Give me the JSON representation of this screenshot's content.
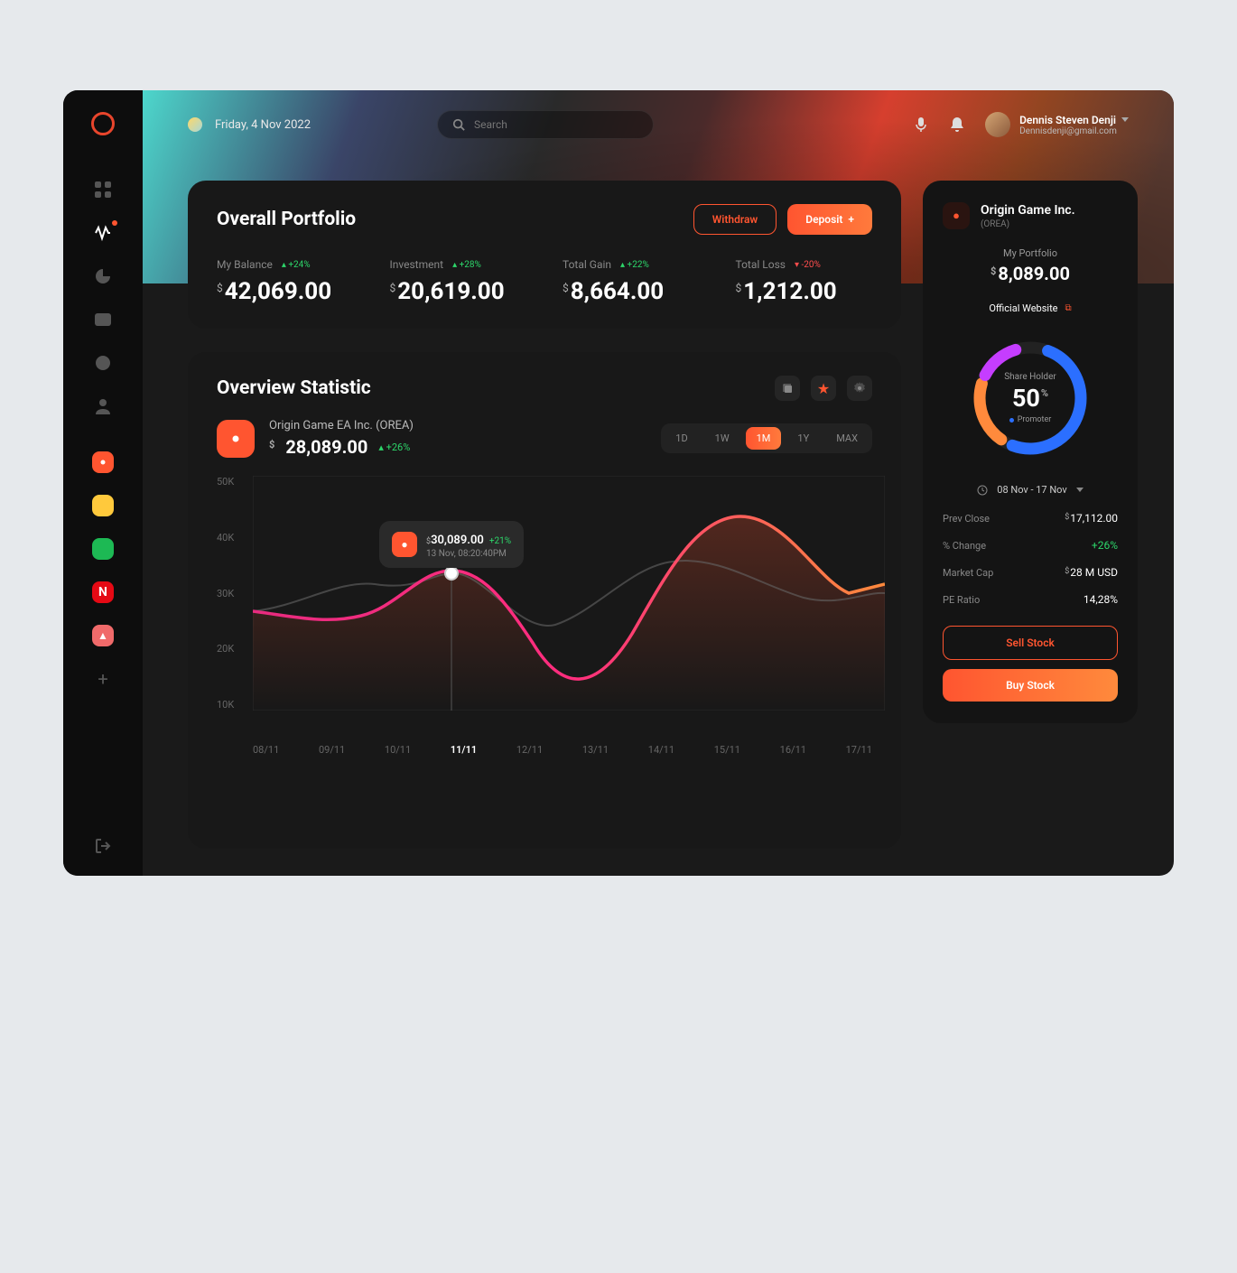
{
  "topbar": {
    "date": "Friday, 4 Nov 2022",
    "search_placeholder": "Search",
    "user_name": "Dennis Steven Denji",
    "user_email": "Dennisdenji@gmail.com"
  },
  "sidebar": {
    "nav": [
      "dashboard",
      "activity",
      "analytics",
      "wallet",
      "messages",
      "profile"
    ],
    "watchlist": [
      "origin",
      "bee",
      "spotify",
      "netflix",
      "asana"
    ]
  },
  "portfolio": {
    "title": "Overall Portfolio",
    "withdraw_label": "Withdraw",
    "deposit_label": "Deposit",
    "metrics": [
      {
        "label": "My Balance",
        "change": "+24%",
        "dir": "up",
        "value": "42,069.00"
      },
      {
        "label": "Investment",
        "change": "+28%",
        "dir": "up",
        "value": "20,619.00"
      },
      {
        "label": "Total Gain",
        "change": "+22%",
        "dir": "up",
        "value": "8,664.00"
      },
      {
        "label": "Total Loss",
        "change": "-20%",
        "dir": "down",
        "value": "1,212.00"
      }
    ]
  },
  "overview": {
    "title": "Overview Statistic",
    "stock_name": "Origin Game EA Inc. (OREA)",
    "stock_price": "28,089.00",
    "stock_change": "+26%",
    "ranges": [
      "1D",
      "1W",
      "1M",
      "1Y",
      "MAX"
    ],
    "range_active": "1M",
    "tooltip": {
      "price": "30,089.00",
      "change": "+21%",
      "date": "13 Nov, 08:20:40PM"
    },
    "y_labels": [
      "50K",
      "40K",
      "30K",
      "20K",
      "10K"
    ],
    "x_labels": [
      "08/11",
      "09/11",
      "10/11",
      "11/11",
      "12/11",
      "13/11",
      "14/11",
      "15/11",
      "16/11",
      "17/11"
    ],
    "x_active_index": 3
  },
  "detail": {
    "company_name": "Origin Game Inc.",
    "company_ticker": "(OREA)",
    "my_portfolio_label": "My Portfolio",
    "my_portfolio_value": "8,089.00",
    "website_label": "Official Website",
    "donut": {
      "label": "Share Holder",
      "value": "50",
      "legend": "Promoter"
    },
    "date_range": "08 Nov - 17 Nov",
    "stats": [
      {
        "label": "Prev Close",
        "value": "17,112.00",
        "prefix": "$"
      },
      {
        "label": "% Change",
        "value": "+26%",
        "green": true
      },
      {
        "label": "Market Cap",
        "value": "28 M USD",
        "prefix": "$"
      },
      {
        "label": "PE Ratio",
        "value": "14,28%"
      }
    ],
    "sell_label": "Sell Stock",
    "buy_label": "Buy Stock"
  },
  "chart_data": {
    "type": "line",
    "title": "Overview Statistic",
    "xlabel": "",
    "ylabel": "",
    "ylim": [
      10000,
      50000
    ],
    "x_ticks": [
      "08/11",
      "09/11",
      "10/11",
      "11/11",
      "12/11",
      "13/11",
      "14/11",
      "15/11",
      "16/11",
      "17/11"
    ],
    "series": [
      {
        "name": "OREA (white)",
        "values": [
          27000,
          30000,
          29000,
          30089,
          22000,
          28000,
          32500,
          30500,
          28500,
          29500
        ]
      },
      {
        "name": "OREA (gradient)",
        "values": [
          27000,
          26000,
          28000,
          32000,
          30000,
          16000,
          32000,
          39000,
          27000,
          28500
        ]
      }
    ]
  }
}
